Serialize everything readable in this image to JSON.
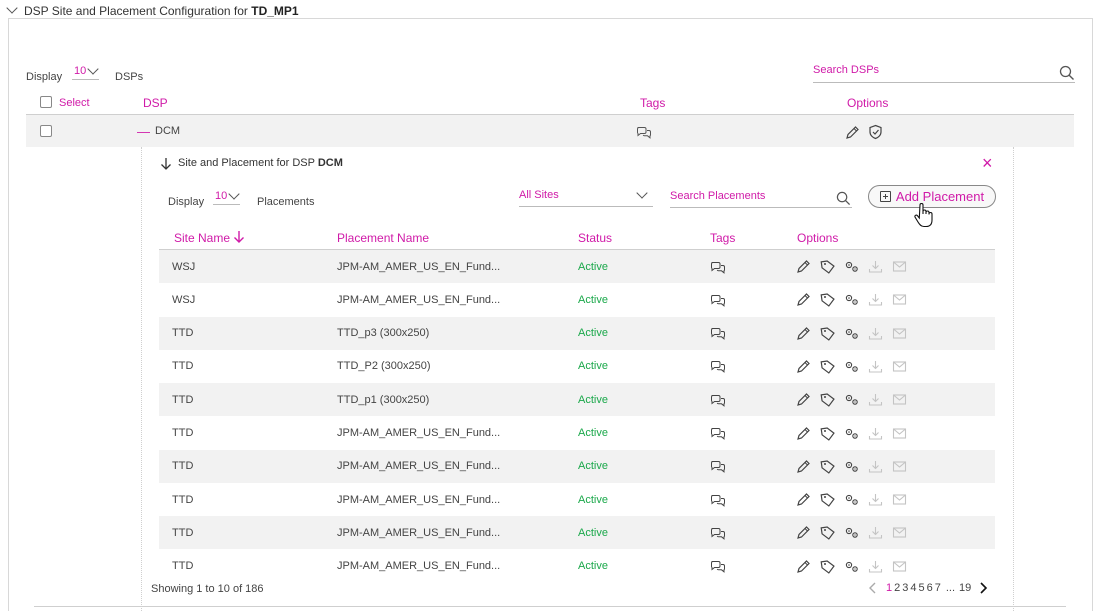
{
  "section": {
    "title_prefix": "DSP Site and Placement Configuration for",
    "title_bold": "TD_MP1"
  },
  "dsp_list": {
    "display_label": "Display",
    "page_size": "10",
    "units_label": "DSPs",
    "search_placeholder": "Search DSPs",
    "headers": {
      "select": "Select",
      "dsp": "DSP",
      "tags": "Tags",
      "options": "Options"
    },
    "rows": [
      {
        "dsp": "DCM",
        "expanded_marker": "—"
      }
    ]
  },
  "placements_panel": {
    "title_prefix": "Site and Placement for DSP",
    "title_bold": "DCM",
    "close_symbol": "×",
    "display_label": "Display",
    "page_size": "10",
    "units_label": "Placements",
    "site_filter": "All Sites",
    "search_placeholder": "Search Placements",
    "add_button": "Add Placement",
    "headers": {
      "site_name": "Site Name",
      "placement_name": "Placement Name",
      "status": "Status",
      "tags": "Tags",
      "options": "Options"
    },
    "rows": [
      {
        "site": "WSJ",
        "placement": "JPM-AM_AMER_US_EN_Fund...",
        "status": "Active"
      },
      {
        "site": "WSJ",
        "placement": "JPM-AM_AMER_US_EN_Fund...",
        "status": "Active"
      },
      {
        "site": "TTD",
        "placement": "TTD_p3 (300x250)",
        "status": "Active"
      },
      {
        "site": "TTD",
        "placement": "TTD_P2 (300x250)",
        "status": "Active"
      },
      {
        "site": "TTD",
        "placement": "TTD_p1 (300x250)",
        "status": "Active"
      },
      {
        "site": "TTD",
        "placement": "JPM-AM_AMER_US_EN_Fund...",
        "status": "Active"
      },
      {
        "site": "TTD",
        "placement": "JPM-AM_AMER_US_EN_Fund...",
        "status": "Active"
      },
      {
        "site": "TTD",
        "placement": "JPM-AM_AMER_US_EN_Fund...",
        "status": "Active"
      },
      {
        "site": "TTD",
        "placement": "JPM-AM_AMER_US_EN_Fund...",
        "status": "Active"
      },
      {
        "site": "TTD",
        "placement": "JPM-AM_AMER_US_EN_Fund...",
        "status": "Active"
      }
    ],
    "footer": {
      "showing": "Showing 1 to 10 of 186",
      "pages": [
        "1",
        "2",
        "3",
        "4",
        "5",
        "6",
        "7"
      ],
      "ellipsis": "...",
      "last_page": "19"
    }
  },
  "colors": {
    "accent": "#d01aa8",
    "status_active": "#1aa84a",
    "row_shade": "#f2f2f2"
  }
}
